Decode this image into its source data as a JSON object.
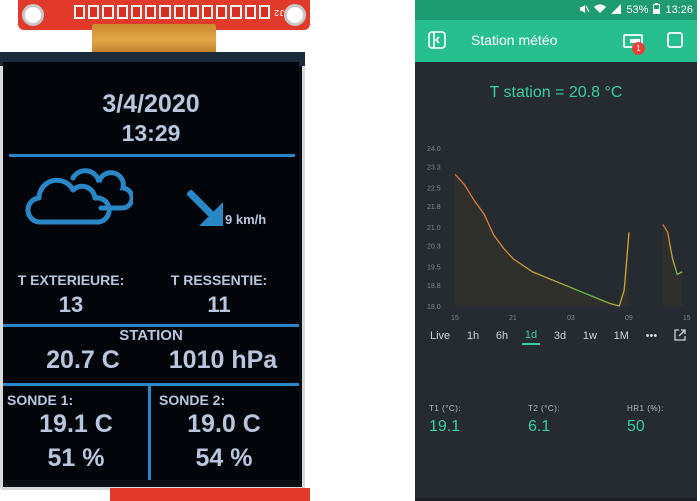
{
  "tft": {
    "pcb_label": "J2",
    "date": "3/4/2020",
    "time": "13:29",
    "wind_speed": "9 km/h",
    "t_ext_label": "T EXTERIEURE:",
    "t_ext_value": "13",
    "t_res_label": "T RESSENTIE:",
    "t_res_value": "11",
    "station_label": "STATION",
    "station_temp": "20.7 C",
    "station_pressure": "1010 hPa",
    "sonde1_label": "SONDE 1:",
    "sonde1_temp": "19.1 C",
    "sonde1_hum": "51 %",
    "sonde2_label": "SONDE 2:",
    "sonde2_temp": "19.0 C",
    "sonde2_hum": "54 %",
    "icons": {
      "weather": "cloud-icon",
      "wind": "wind-arrow-icon"
    },
    "colors": {
      "accent": "#2a87c6",
      "text": "#b9c7de",
      "background": "#02050a"
    }
  },
  "phone": {
    "status": {
      "battery": "53%",
      "time": "13:26"
    },
    "app_bar": {
      "title": "Station météo",
      "notification_count": "1"
    },
    "temp_title": "T station = 20.8 °C",
    "time_ranges": [
      "Live",
      "1h",
      "6h",
      "1d",
      "3d",
      "1w",
      "1M"
    ],
    "active_range": "1d",
    "more_label": "•••",
    "values": [
      {
        "label": "T1 (°C):",
        "value": "19.1"
      },
      {
        "label": "T2 (°C):",
        "value": "6.1"
      },
      {
        "label": "HR1 (%):",
        "value": "50"
      }
    ],
    "colors": {
      "accent": "#34d19c",
      "header": "#28bf8f",
      "status_bar": "#1f9b72",
      "background": "#262a31"
    }
  },
  "chart_data": {
    "type": "line",
    "y_ticks": [
      "24.0",
      "23.3",
      "22.5",
      "21.8",
      "21.0",
      "20.3",
      "19.5",
      "18.8",
      "18.0"
    ],
    "x_ticks": [
      "15",
      "21",
      "03",
      "09",
      "15"
    ],
    "ylim": [
      18.0,
      24.0
    ],
    "series": [
      {
        "x": [
          "15:00",
          "16:00",
          "17:00",
          "18:00",
          "19:00",
          "20:00",
          "21:00",
          "23:00",
          "01:00",
          "03:00",
          "05:00",
          "07:00",
          "08:00",
          "08:30",
          "09:00"
        ],
        "values": [
          23.0,
          22.6,
          22.0,
          21.5,
          20.7,
          20.2,
          19.8,
          19.3,
          19.0,
          18.7,
          18.4,
          18.1,
          18.0,
          18.6,
          20.8
        ]
      },
      {
        "x": [
          "12:30",
          "13:00",
          "13:30",
          "14:00",
          "14:30"
        ],
        "values": [
          21.1,
          20.8,
          19.8,
          19.2,
          19.3
        ]
      }
    ]
  }
}
